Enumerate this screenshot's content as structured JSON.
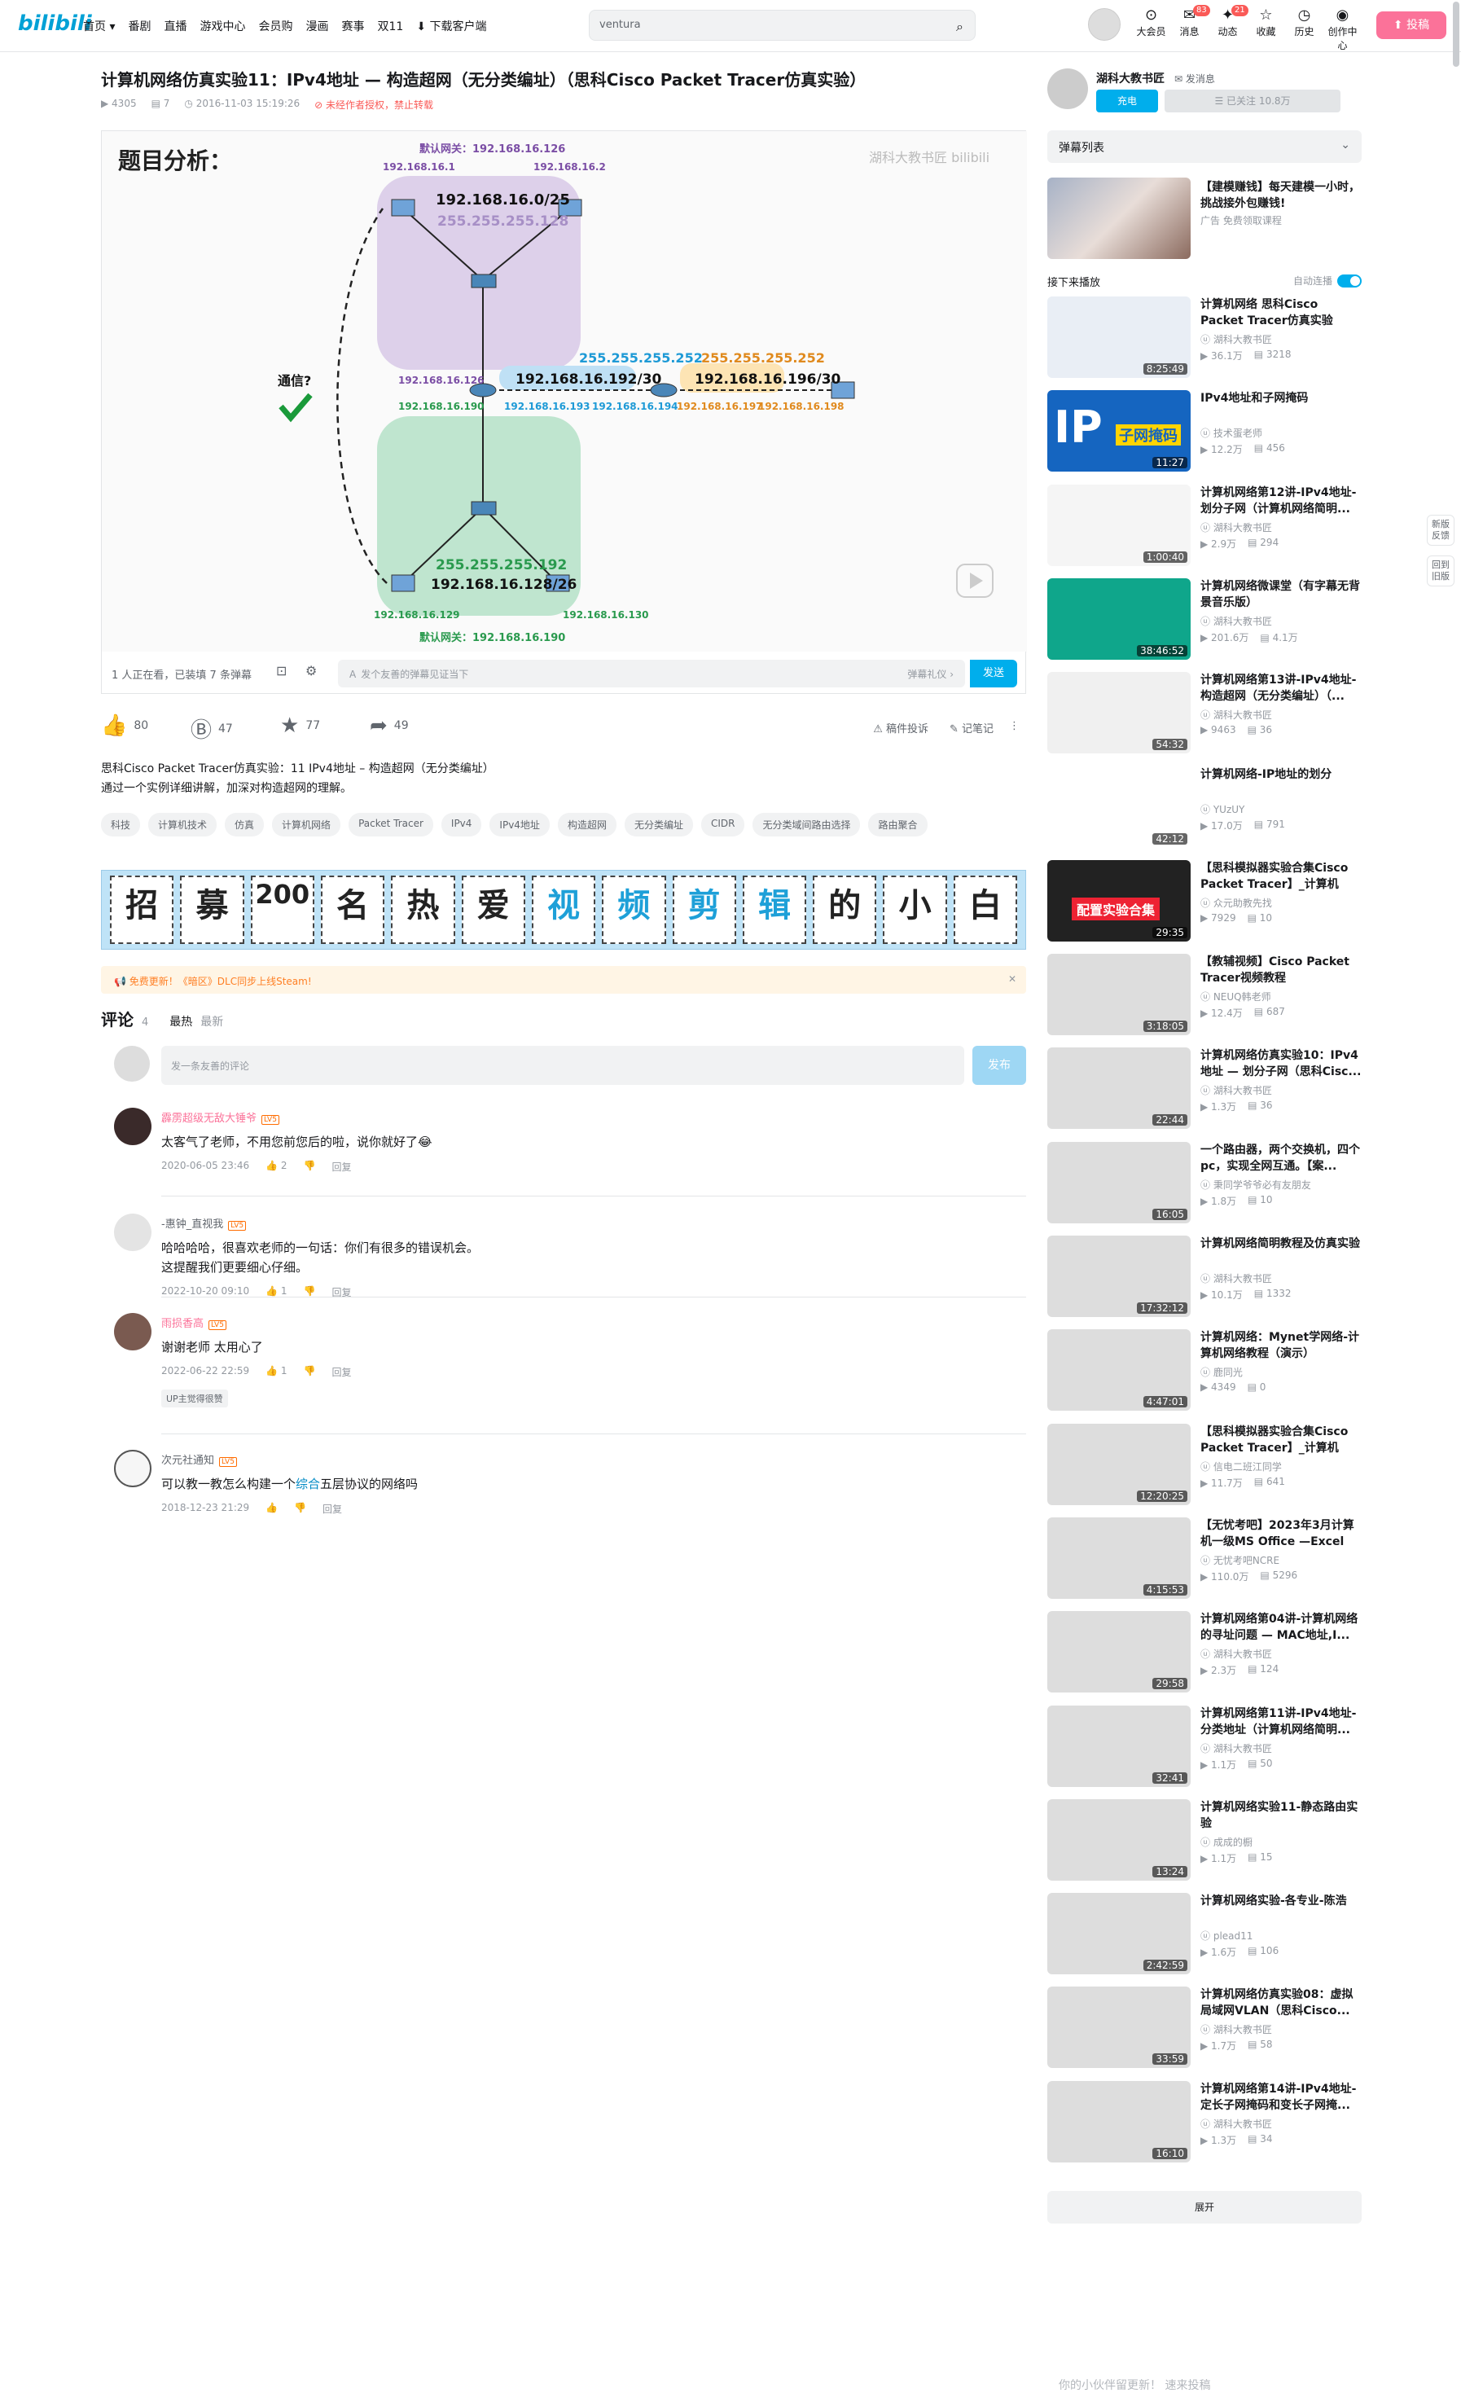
{
  "header": {
    "logo": "bilibili",
    "nav": [
      "首页 ▾",
      "番剧",
      "直播",
      "游戏中心",
      "会员购",
      "漫画",
      "赛事",
      "双11",
      "⬇ 下载客户端"
    ],
    "search_value": "ventura",
    "icons": [
      {
        "label": "大会员",
        "icon": "vip-icon",
        "glyph": "⊙",
        "badge": ""
      },
      {
        "label": "消息",
        "icon": "message-icon",
        "glyph": "✉",
        "badge": "83"
      },
      {
        "label": "动态",
        "icon": "dynamic-icon",
        "glyph": "✦",
        "badge": "21"
      },
      {
        "label": "收藏",
        "icon": "favorite-icon",
        "glyph": "☆",
        "badge": ""
      },
      {
        "label": "历史",
        "icon": "history-icon",
        "glyph": "◷",
        "badge": ""
      },
      {
        "label": "创作中心",
        "icon": "creator-icon",
        "glyph": "◉",
        "badge": ""
      }
    ],
    "upload": "⬆ 投稿",
    "accent": "#fb7299"
  },
  "video": {
    "title": "计算机网络仿真实验11：IPv4地址 — 构造超网（无分类编址）（思科Cisco Packet Tracer仿真实验）",
    "views": "4305",
    "danmaku": "7",
    "date": "2016-11-03 15:19:26",
    "copyright": "未经作者授权，禁止转载"
  },
  "player": {
    "heading": "题目分析：",
    "watermark": "湖科大教书匠 bilibili",
    "gateway_top": "默认网关：192.168.16.126",
    "gateway_bottom": "默认网关：192.168.16.190",
    "net1": "192.168.16.0/25",
    "mask1": "255.255.255.128",
    "net2": "192.168.16.128/26",
    "mask2": "255.255.255.192",
    "net3": "192.168.16.192/30",
    "mask3": "255.255.255.252",
    "net4": "192.168.16.196/30",
    "mask4": "255.255.255.252",
    "pc1": "192.168.16.1",
    "pc2": "192.168.16.2",
    "pc3": "192.168.16.129",
    "pc4": "192.168.16.130",
    "r1a": "192.168.16.126",
    "r1b": "192.168.16.190",
    "r1c": "192.168.16.193",
    "r2a": "192.168.16.194",
    "r2b": "192.168.16.197",
    "r3": "192.168.16.198",
    "comm": "通信?"
  },
  "bar": {
    "watching": "1 人正在看，已装填 7 条弹幕",
    "input": "发个友善的弹幕见证当下",
    "etiquette": "弹幕礼仪 ›",
    "send": "发送"
  },
  "actions": {
    "like": "80",
    "coin": "47",
    "fav": "77",
    "share": "49",
    "report": "稿件投诉",
    "note": "记笔记"
  },
  "description": [
    "思科Cisco Packet Tracer仿真实验：11 IPv4地址 – 构造超网（无分类编址）",
    "通过一个实例详细讲解，加深对构造超网的理解。"
  ],
  "tags": [
    "科技",
    "计算机技术",
    "仿真",
    "计算机网络",
    "Packet Tracer",
    "IPv4",
    "IPv4地址",
    "构造超网",
    "无分类编址",
    "CIDR",
    "无分类域间路由选择",
    "路由聚合"
  ],
  "banner": [
    "招",
    "募",
    "200",
    "名",
    "热",
    "爱",
    "视",
    "频",
    "剪",
    "辑",
    "的",
    "小",
    "白"
  ],
  "notice": "免费更新！《暗区》DLC同步上线Steam!",
  "comments": {
    "title": "评论",
    "count": "4",
    "sort_hot": "最热",
    "sort_new": "最新",
    "placeholder": "发一条友善的评论",
    "publish": "发布",
    "items": [
      {
        "name": "霹雳超级无敌大锤爷",
        "text": "太客气了老师，不用您前您后的啦，说你就好了😂",
        "date": "2020-06-05 23:46",
        "likes": "2",
        "reply": "回复",
        "badge": ""
      },
      {
        "name": "-惠钟_直视我",
        "text": "哈哈哈哈，很喜欢老师的一句话：你们有很多的错误机会。\n这提醒我们更要细心仔细。",
        "date": "2022-10-20 09:10",
        "likes": "1",
        "reply": "回复",
        "badge": ""
      },
      {
        "name": "雨损香高",
        "text": "谢谢老师 太用心了",
        "date": "2022-06-22 22:59",
        "likes": "1",
        "reply": "回复",
        "badge": "UP主觉得很赞"
      },
      {
        "name": "次元社通知",
        "text": "可以教一教怎么构建一个综合五层协议的网络吗",
        "date": "2018-12-23 21:29",
        "likes": "",
        "reply": "回复",
        "badge": ""
      }
    ]
  },
  "sidebar": {
    "up_name": "湖科大教书匠",
    "up_msg": "✉ 发消息",
    "charge": "充电",
    "follow": "☰ 已关注 10.8万",
    "danmaku_list": "弹幕列表",
    "ad": {
      "title": "【建模赚钱】每天建模一小时，挑战接外包赚钱!",
      "sub": "广告 免费领取课程"
    },
    "next": "接下来播放",
    "autoplay": "自动连播",
    "videos": [
      {
        "title": "计算机网络 思科Cisco Packet Tracer仿真实验",
        "author": "湖科大教书匠",
        "plays": "36.1万",
        "dm": "3218",
        "dur": "8:25:49"
      },
      {
        "title": "IPv4地址和子网掩码",
        "author": "技术蛋老师",
        "plays": "12.2万",
        "dm": "456",
        "dur": "11:27"
      },
      {
        "title": "计算机网络第12讲-IPv4地址-划分子网（计算机网络简明...",
        "author": "湖科大教书匠",
        "plays": "2.9万",
        "dm": "294",
        "dur": "1:00:40"
      },
      {
        "title": "计算机网络微课堂（有字幕无背景音乐版）",
        "author": "湖科大教书匠",
        "plays": "201.6万",
        "dm": "4.1万",
        "dur": "38:46:52"
      },
      {
        "title": "计算机网络第13讲-IPv4地址-构造超网（无分类编址）（...",
        "author": "湖科大教书匠",
        "plays": "9463",
        "dm": "36",
        "dur": "54:32"
      },
      {
        "title": "计算机网络-IP地址的划分",
        "author": "YUzUY",
        "plays": "17.0万",
        "dm": "791",
        "dur": "42:12"
      },
      {
        "title": "【思科模拟器实验合集Cisco Packet Tracer】_计算机网...",
        "author": "众元助教先找",
        "plays": "7929",
        "dm": "10",
        "dur": "29:35"
      },
      {
        "title": "【教辅视频】Cisco Packet Tracer视频教程",
        "author": "NEUQ韩老师",
        "plays": "12.4万",
        "dm": "687",
        "dur": "3:18:05"
      },
      {
        "title": "计算机网络仿真实验10：IPv4地址 — 划分子网（思科Cisc...",
        "author": "湖科大教书匠",
        "plays": "1.3万",
        "dm": "36",
        "dur": "22:44"
      },
      {
        "title": "一个路由器，两个交换机，四个pc，实现全网互通。【案...",
        "author": "秉同学爷爷必有友朋友",
        "plays": "1.8万",
        "dm": "10",
        "dur": "16:05"
      },
      {
        "title": "计算机网络简明教程及仿真实验",
        "author": "湖科大教书匠",
        "plays": "10.1万",
        "dm": "1332",
        "dur": "17:32:12"
      },
      {
        "title": "计算机网络：Mynet学网络-计算机网络教程（演示）",
        "author": "鹿同光",
        "plays": "4349",
        "dm": "0",
        "dur": "4:47:01"
      },
      {
        "title": "【思科模拟器实验合集Cisco Packet Tracer】_计算机网...",
        "author": "信电二班江同学",
        "plays": "11.7万",
        "dm": "641",
        "dur": "12:20:25"
      },
      {
        "title": "【无忧考吧】2023年3月计算机一级MS Office —Excel真...",
        "author": "无忧考吧NCRE",
        "plays": "110.0万",
        "dm": "5296",
        "dur": "4:15:53"
      },
      {
        "title": "计算机网络第04讲-计算机网络的寻址问题 — MAC地址,I...",
        "author": "湖科大教书匠",
        "plays": "2.3万",
        "dm": "124",
        "dur": "29:58"
      },
      {
        "title": "计算机网络第11讲-IPv4地址-分类地址（计算机网络简明...",
        "author": "湖科大教书匠",
        "plays": "1.1万",
        "dm": "50",
        "dur": "32:41"
      },
      {
        "title": "计算机网络实验11-静态路由实验",
        "author": "成成的橱",
        "plays": "1.1万",
        "dm": "15",
        "dur": "13:24"
      },
      {
        "title": "计算机网络实验-各专业-陈浩",
        "author": "plead11",
        "plays": "1.6万",
        "dm": "106",
        "dur": "2:42:59"
      },
      {
        "title": "计算机网络仿真实验08：虚拟局域网VLAN（思科Cisco...",
        "author": "湖科大教书匠",
        "plays": "1.7万",
        "dm": "58",
        "dur": "33:59"
      },
      {
        "title": "计算机网络第14讲-IPv4地址-定长子网掩码和变长子网掩...",
        "author": "湖科大教书匠",
        "plays": "1.3万",
        "dm": "34",
        "dur": "16:10"
      }
    ],
    "more": "展开"
  },
  "float": [
    "新版反馈",
    "回到旧版"
  ],
  "footer_hint": "你的小伙伴留更新！ 速来投稿"
}
